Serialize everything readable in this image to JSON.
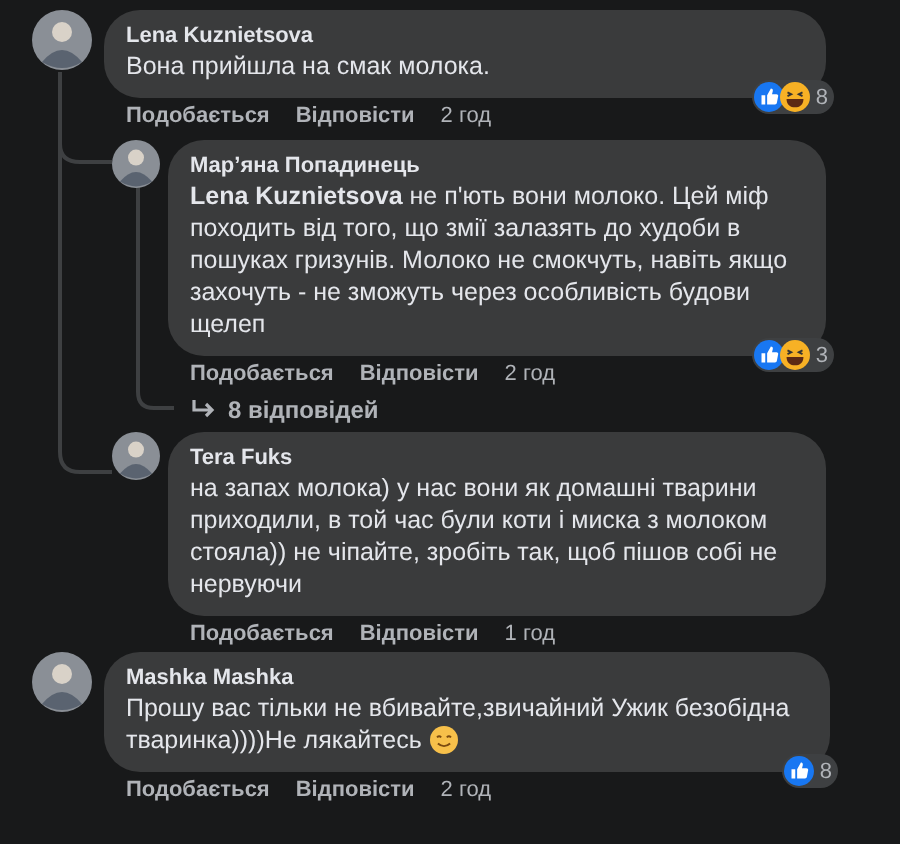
{
  "comments": [
    {
      "author": "Lena Kuznietsova",
      "text": "Вона прийшла на смак молока.",
      "reactions": {
        "like": true,
        "haha": true,
        "count": "8"
      },
      "actions": [
        "Подобається",
        "Відповісти"
      ],
      "time": "2 год",
      "replies": [
        {
          "author": "Мар’яна Попадинець",
          "text": "**Lena Kuznietsova** не п'ють вони молоко. Цей міф походить від того, що змії залазять до худоби в пошуках гризунів. Молоко не смокчуть, навіть якщо захочуть - не зможуть через особливість будови щелеп",
          "reactions": {
            "like": true,
            "haha": true,
            "count": "3"
          },
          "actions": [
            "Подобається",
            "Відповісти"
          ],
          "time": "2 год",
          "more_replies": "8 відповідей"
        },
        {
          "author": "Tera Fuks",
          "text": "на запах молока) у нас вони як домашні тварини приходили, в той час були коти і миска з молоком стояла)) не чіпайте, зробіть так, щоб пішов собі не нервуючи",
          "actions": [
            "Подобається",
            "Відповісти"
          ],
          "time": "1 год"
        }
      ]
    },
    {
      "author": "Mashka Mashka",
      "text": "Прошу вас тільки не вбивайте,звичайний Ужик безобідна тваринка))))Не лякайтесь",
      "ends_with_smiley": true,
      "reactions": {
        "like": true,
        "haha": false,
        "count": "8"
      },
      "actions": [
        "Подобається",
        "Відповісти"
      ],
      "time": "2 год"
    }
  ]
}
